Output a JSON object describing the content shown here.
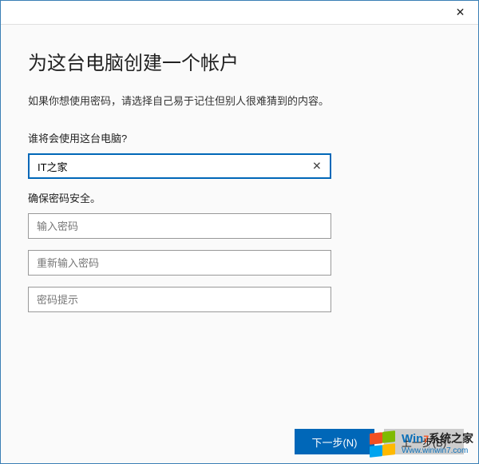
{
  "titlebar": {
    "close": "✕"
  },
  "heading": "为这台电脑创建一个帐户",
  "subtitle": "如果你想使用密码，请选择自己易于记住但别人很难猜到的内容。",
  "section_user_label": "谁将会使用这台电脑?",
  "username": {
    "value": "IT之家",
    "clear_icon": "✕"
  },
  "section_pwd_label": "确保密码安全。",
  "password": {
    "placeholder": "输入密码"
  },
  "password_confirm": {
    "placeholder": "重新输入密码"
  },
  "password_hint": {
    "placeholder": "密码提示"
  },
  "buttons": {
    "next": "下一步(N)",
    "back": "上一步(B)"
  },
  "watermark": {
    "brand_a": "Win",
    "brand_b": "7",
    "brand_c": "系统之家",
    "url": "Www.winwin7.com"
  }
}
